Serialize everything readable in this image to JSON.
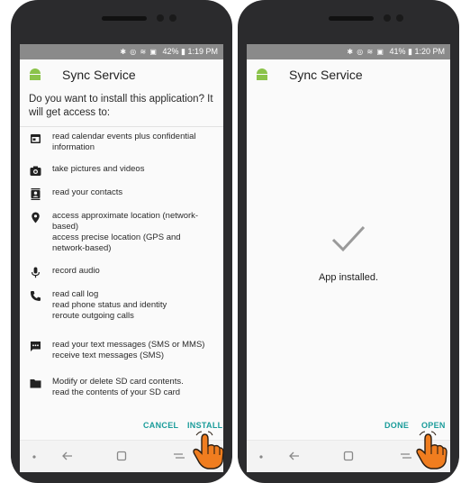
{
  "left_screen": {
    "status": {
      "icons": "✱ ◎ ≋ ▣",
      "battery": "42%",
      "time": "1:19 PM"
    },
    "app_title": "Sync Service",
    "question": "Do you want to install this application? It will get access to:",
    "permissions": [
      {
        "icon": "calendar-icon",
        "lines": [
          "read calendar events plus confidential",
          "information"
        ]
      },
      {
        "icon": "camera-icon",
        "lines": [
          "take pictures and videos"
        ]
      },
      {
        "icon": "contacts-icon",
        "lines": [
          "read your contacts"
        ]
      },
      {
        "icon": "location-icon",
        "lines": [
          "access approximate location (network-",
          "based)",
          "access precise location (GPS and",
          "network-based)"
        ]
      },
      {
        "icon": "microphone-icon",
        "lines": [
          "record audio"
        ]
      },
      {
        "icon": "phone-icon",
        "lines": [
          "read call log",
          "read phone status and identity",
          "reroute outgoing calls"
        ]
      },
      {
        "icon": "sms-icon",
        "lines": [
          "read your text messages (SMS or MMS)",
          "receive text messages (SMS)"
        ]
      },
      {
        "icon": "folder-icon",
        "lines": [
          "Modify or delete SD card contents.",
          "read the contents of your SD card"
        ]
      }
    ],
    "cancel_label": "CANCEL",
    "install_label": "INSTALL"
  },
  "right_screen": {
    "status": {
      "icons": "✱ ◎ ≋ ▣",
      "battery": "41%",
      "time": "1:20 PM"
    },
    "app_title": "Sync Service",
    "installed_text": "App installed.",
    "done_label": "DONE",
    "open_label": "OPEN"
  },
  "colors": {
    "accent": "#1a9c9a",
    "android_green": "#8bc34a",
    "status_bar": "#8a8a8a",
    "hand_orange": "#f07d1f"
  }
}
